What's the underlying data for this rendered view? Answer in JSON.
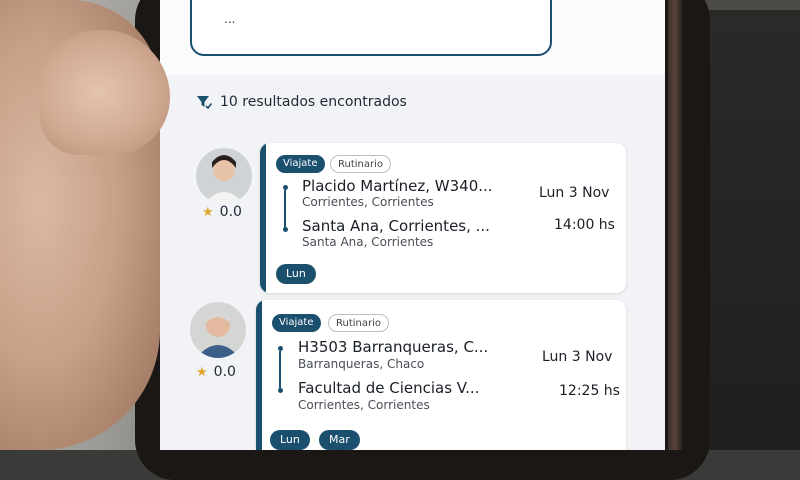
{
  "search": {
    "placeholder": "..."
  },
  "results": {
    "text": "10 resultados encontrados"
  },
  "trips": [
    {
      "rating": "0.0",
      "tags": [
        "Viajate",
        "Rutinario"
      ],
      "origin": {
        "place": "Placido Martínez, W340...",
        "sub": "Corrientes, Corrientes"
      },
      "destination": {
        "place": "Santa Ana, Corrientes, ...",
        "sub": "Santa Ana, Corrientes"
      },
      "date": "Lun 3 Nov",
      "time": "14:00 hs",
      "days": [
        "Lun"
      ]
    },
    {
      "rating": "0.0",
      "tags": [
        "Viajate",
        "Rutinario"
      ],
      "origin": {
        "place": "H3503 Barranqueras, C...",
        "sub": "Barranqueras, Chaco"
      },
      "destination": {
        "place": "Facultad de Ciencias V...",
        "sub": "Corrientes, Corrientes"
      },
      "date": "Lun 3 Nov",
      "time": "12:25 hs",
      "days": [
        "Lun",
        "Mar"
      ]
    }
  ],
  "colors": {
    "accent": "#1b4f6e",
    "star": "#e2a52a"
  },
  "icons": {
    "close": "close-icon",
    "filter": "filter-icon",
    "star": "star-icon"
  }
}
